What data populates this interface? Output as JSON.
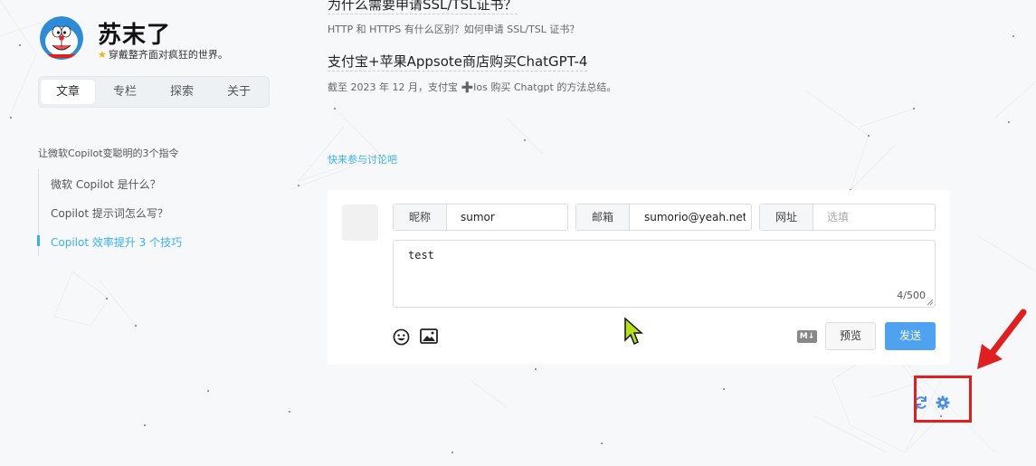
{
  "site": {
    "title": "苏末了",
    "subtitle": "穿戴整齐面对疯狂的世界。"
  },
  "nav": {
    "tabs": [
      {
        "label": "文章",
        "active": true
      },
      {
        "label": "专栏",
        "active": false
      },
      {
        "label": "探索",
        "active": false
      },
      {
        "label": "关于",
        "active": false
      }
    ]
  },
  "toc": {
    "title": "让微软Copilot变聪明的3个指令",
    "items": [
      {
        "label": "微软 Copilot 是什么？",
        "active": false
      },
      {
        "label": "Copilot 提示词怎么写？",
        "active": false
      },
      {
        "label": "Copilot 效率提升 3 个技巧",
        "active": true
      }
    ]
  },
  "articles": [
    {
      "title": "为什么需要申请SSL/TSL证书？",
      "desc": "HTTP 和 HTTPS 有什么区别？如何申请 SSL/TSL 证书？"
    },
    {
      "title": "支付宝+苹果Appsote商店购买ChatGPT-4",
      "desc": "截至 2023 年 12 月，支付宝 ➕Ios 购买 Chatgpt 的方法总结。"
    }
  ],
  "discuss_link": "快来参与讨论吧",
  "comment": {
    "nickname_label": "昵称",
    "nickname_value": "sumor",
    "email_label": "邮箱",
    "email_value": "sumorio@yeah.net",
    "url_label": "网址",
    "url_placeholder": "选填",
    "content": "test",
    "word_count": "4/500",
    "preview_label": "预览",
    "send_label": "发送",
    "markdown_badge": "M↓"
  },
  "colors": {
    "accent": "#3bb0f0",
    "send_button": "#4ea2f0",
    "annotation": "#e02020",
    "icon_blue": "#4a90e2"
  },
  "icons": [
    "emoji-icon",
    "image-icon",
    "markdown-icon",
    "refresh-icon",
    "gear-icon",
    "star-icon",
    "cursor-icon",
    "annotation-arrow-icon"
  ]
}
